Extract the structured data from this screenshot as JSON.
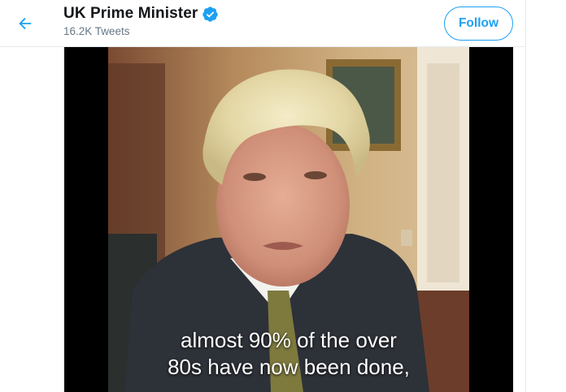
{
  "header": {
    "back_icon": "arrow-left-icon",
    "name": "UK Prime Minister",
    "verified_icon": "verified-badge-icon",
    "tweet_count": "16.2K Tweets",
    "follow_label": "Follow"
  },
  "video": {
    "subtitle_line1": "almost 90% of the over",
    "subtitle_line2": "80s have now been done,"
  },
  "colors": {
    "accent": "#1da1f2",
    "text_primary": "#14171a",
    "text_secondary": "#657786"
  }
}
